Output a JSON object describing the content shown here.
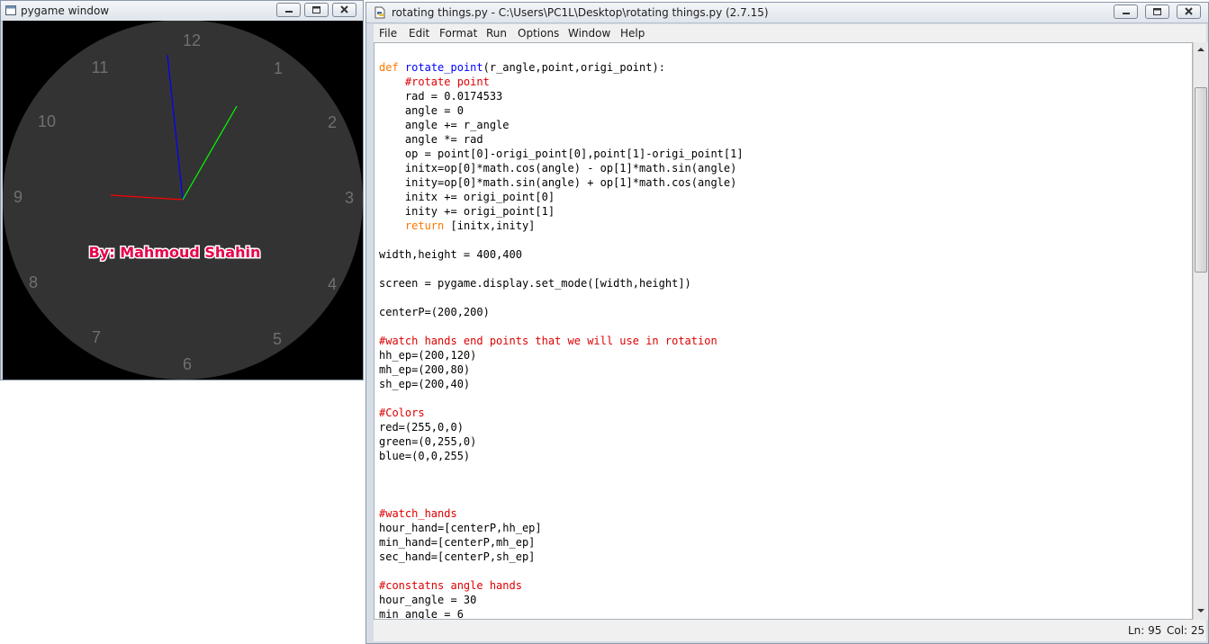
{
  "pygame_window": {
    "title": "pygame window",
    "clock": {
      "numbers": [
        "12",
        "1",
        "2",
        "3",
        "4",
        "5",
        "6",
        "7",
        "8",
        "9",
        "10",
        "11"
      ],
      "credit": "By: Mahmoud Shahin",
      "hand_colors": {
        "hour": "#ff0000",
        "minute": "#0000ff",
        "second": "#00ff00"
      },
      "face_color": "#333333"
    }
  },
  "idle_window": {
    "title": "rotating things.py - C:\\Users\\PC1L\\Desktop\\rotating things.py (2.7.15)",
    "menu": [
      "File",
      "Edit",
      "Format",
      "Run",
      "Options",
      "Window",
      "Help"
    ],
    "code": [
      {
        "t": "def",
        "c": "kw"
      },
      {
        "t": " "
      },
      {
        "t": "rotate_point",
        "c": "df"
      },
      {
        "t": "(r_angle,point,origi_point):\n"
      },
      {
        "t": "    "
      },
      {
        "t": "#rotate point",
        "c": "cm"
      },
      {
        "t": "\n"
      },
      {
        "t": "    rad = 0.0174533\n    angle = 0\n    angle += r_angle\n    angle *= rad\n    op = point[0]-origi_point[0],point[1]-origi_point[1]\n    initx=op[0]*math.cos(angle) - op[1]*math.sin(angle)\n    inity=op[0]*math.sin(angle) + op[1]*math.cos(angle)\n    initx += origi_point[0]\n    inity += origi_point[1]\n    "
      },
      {
        "t": "return",
        "c": "kw"
      },
      {
        "t": " [initx,inity]\n\nwidth,height = 400,400\n\nscreen = pygame.display.set_mode([width,height])\n\ncenterP=(200,200)\n\n"
      },
      {
        "t": "#watch hands end points that we will use in rotation",
        "c": "cm"
      },
      {
        "t": "\n"
      },
      {
        "t": "hh_ep=(200,120)\nmh_ep=(200,80)\nsh_ep=(200,40)\n\n"
      },
      {
        "t": "#Colors",
        "c": "cm"
      },
      {
        "t": "\n"
      },
      {
        "t": "red=(255,0,0)\ngreen=(0,255,0)\nblue=(0,0,255)\n\n\n\n"
      },
      {
        "t": "#watch_hands",
        "c": "cm"
      },
      {
        "t": "\n"
      },
      {
        "t": "hour_hand=[centerP,hh_ep]\nmin_hand=[centerP,mh_ep]\nsec_hand=[centerP,sh_ep]\n\n"
      },
      {
        "t": "#constatns angle hands",
        "c": "cm"
      },
      {
        "t": "\n"
      },
      {
        "t": "hour_angle = 30\nmin_angle = 6"
      }
    ],
    "status": {
      "line": "Ln: 95",
      "col": "Col: 25"
    },
    "colors": {
      "keyword": "#ff7700",
      "definition": "#0000ff",
      "comment": "#dd0000"
    }
  }
}
